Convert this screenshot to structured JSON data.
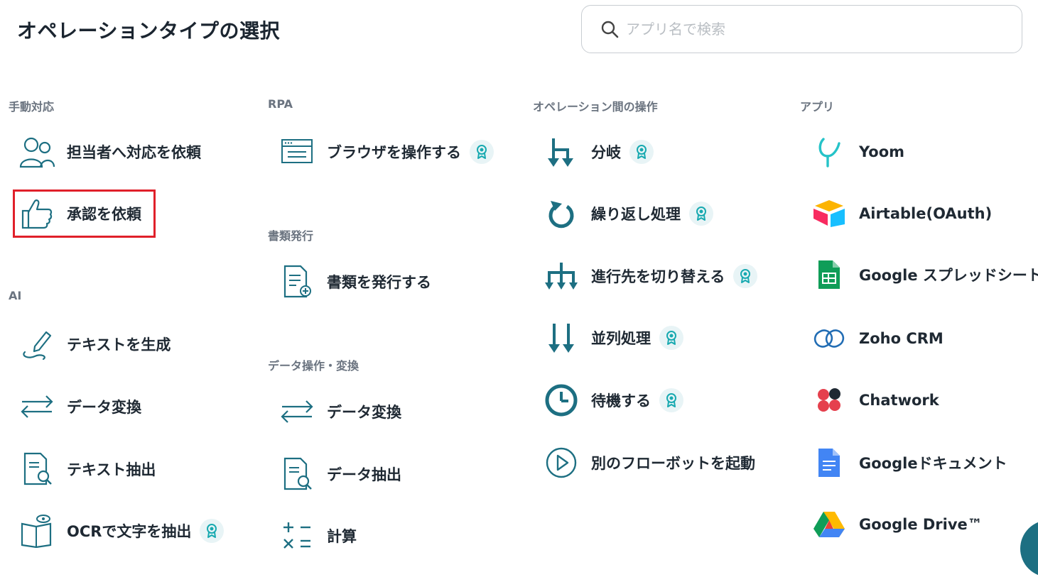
{
  "page": {
    "title": "オペレーションタイプの選択"
  },
  "search": {
    "placeholder": "アプリ名で検索"
  },
  "sections": {
    "manual": {
      "label": "手動対応",
      "items": [
        "担当者へ対応を依頼",
        "承認を依頼"
      ]
    },
    "ai": {
      "label": "AI",
      "items": [
        "テキストを生成",
        "データ変換",
        "テキスト抽出",
        "OCRで文字を抽出"
      ]
    },
    "rpa": {
      "label": "RPA",
      "items": [
        "ブラウザを操作する"
      ]
    },
    "docs": {
      "label": "書類発行",
      "items": [
        "書類を発行する"
      ]
    },
    "data_ops": {
      "label": "データ操作・変換",
      "items": [
        "データ変換",
        "データ抽出",
        "計算"
      ]
    },
    "between_ops": {
      "label": "オペレーション間の操作",
      "items": [
        "分岐",
        "繰り返し処理",
        "進行先を切り替える",
        "並列処理",
        "待機する",
        "別のフローボットを起動"
      ]
    },
    "apps": {
      "label": "アプリ",
      "items": [
        "Yoom",
        "Airtable(OAuth)",
        "Google スプレッドシート",
        "Zoho CRM",
        "Chatwork",
        "Googleドキュメント",
        "Google Drive™"
      ]
    }
  },
  "colors": {
    "accent": "#1d6f82",
    "badge_bg": "#e8f4f6",
    "highlight": "#e0202a",
    "section_label": "#6b7480"
  }
}
